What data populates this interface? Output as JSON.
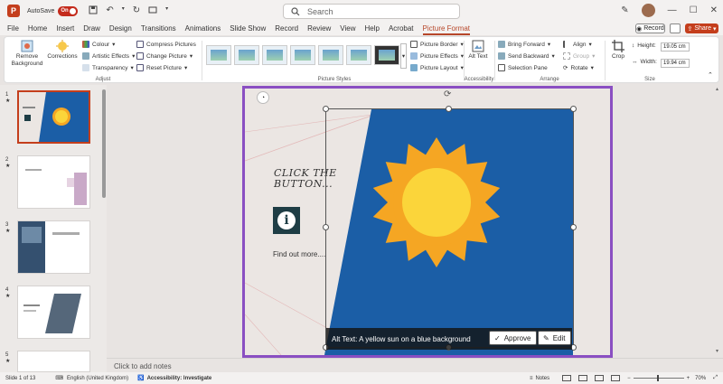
{
  "titlebar": {
    "autosave_label": "AutoSave",
    "autosave_state": "On",
    "search_placeholder": "Search"
  },
  "menu": {
    "tabs": [
      "File",
      "Home",
      "Insert",
      "Draw",
      "Design",
      "Transitions",
      "Animations",
      "Slide Show",
      "Record",
      "Review",
      "View",
      "Help",
      "Acrobat",
      "Picture Format"
    ],
    "active_tab": "Picture Format",
    "record_label": "Record",
    "share_label": "Share"
  },
  "ribbon": {
    "remove_background": "Remove Background",
    "corrections": "Corrections",
    "colour": "Colour",
    "artistic_effects": "Artistic Effects",
    "transparency": "Transparency",
    "compress_pictures": "Compress Pictures",
    "change_picture": "Change Picture",
    "reset_picture": "Reset Picture",
    "adjust_label": "Adjust",
    "picture_border": "Picture Border",
    "picture_effects": "Picture Effects",
    "picture_layout": "Picture Layout",
    "picture_styles_label": "Picture Styles",
    "alt_text": "Alt Text",
    "accessibility_label": "Accessibility",
    "bring_forward": "Bring Forward",
    "send_backward": "Send Backward",
    "selection_pane": "Selection Pane",
    "align": "Align",
    "group": "Group",
    "rotate": "Rotate",
    "arrange_label": "Arrange",
    "crop": "Crop",
    "height_label": "Height:",
    "height_value": "19.05 cm",
    "width_label": "Width:",
    "width_value": "19.94 cm",
    "size_label": "Size"
  },
  "thumbnails": [
    {
      "num": "1",
      "star": "★"
    },
    {
      "num": "2",
      "star": "★"
    },
    {
      "num": "3",
      "star": "★"
    },
    {
      "num": "4",
      "star": "★"
    },
    {
      "num": "5",
      "star": "★"
    }
  ],
  "slide": {
    "heading": "CLICK THE BUTTON...",
    "info_symbol": "i",
    "find_out_more": "Find out more....",
    "alt_text": "Alt Text: A yellow sun on a blue background",
    "approve_label": "Approve",
    "edit_label": "Edit",
    "colors": {
      "blue_panel": "#1b5ea6",
      "sun_outer": "#f5a623",
      "sun_inner": "#fbd53a",
      "info_icon_bg": "#1e3d45",
      "frame": "#8a4fc2"
    }
  },
  "notes_placeholder": "Click to add notes",
  "status": {
    "slide_count": "Slide 1 of 13",
    "language": "English (United Kingdom)",
    "accessibility": "Accessibility: Investigate",
    "notes_label": "Notes",
    "zoom": "70%"
  }
}
